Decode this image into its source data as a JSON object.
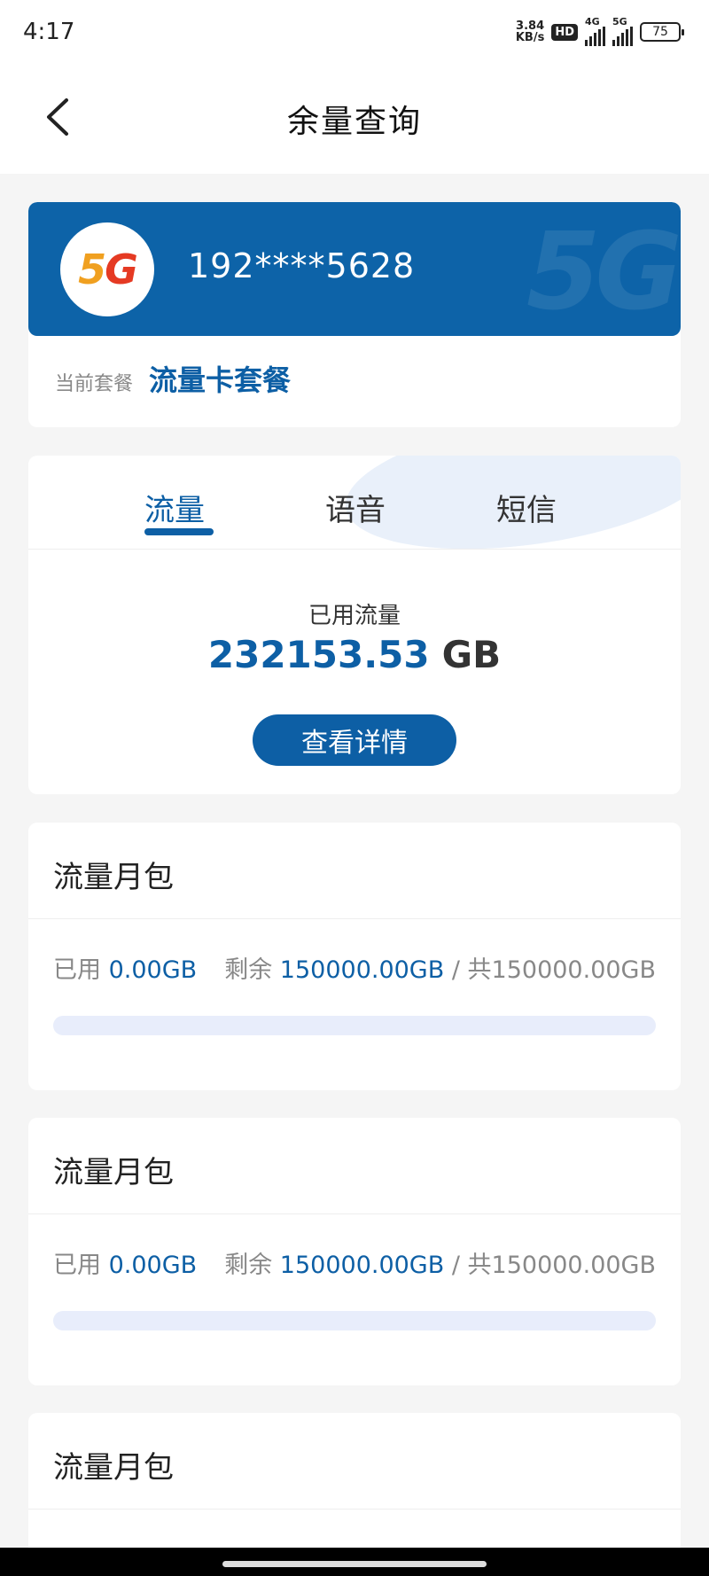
{
  "status_bar": {
    "time": "4:17",
    "net_speed_value": "3.84",
    "net_speed_unit": "KB/s",
    "hd_badge": "HD",
    "signal_1_label": "4G",
    "signal_2_label": "5G",
    "battery": "75"
  },
  "header": {
    "title": "余量查询",
    "back_icon": "chevron-left-icon"
  },
  "user_card": {
    "logo_text": "5G",
    "phone": "192****5628",
    "plan_label": "当前套餐",
    "plan_name": "流量卡套餐"
  },
  "usage": {
    "tabs": [
      {
        "label": "流量",
        "active": true
      },
      {
        "label": "语音",
        "active": false
      },
      {
        "label": "短信",
        "active": false
      }
    ],
    "used_label": "已用流量",
    "used_value": "232153.53",
    "used_unit": "GB",
    "detail_button": "查看详情"
  },
  "packages": [
    {
      "title": "流量月包",
      "used_label": "已用",
      "used_value": "0.00GB",
      "remain_label": "剩余",
      "remain_value": "150000.00GB",
      "total_text": "/ 共150000.00GB",
      "used_fraction": 0
    },
    {
      "title": "流量月包",
      "used_label": "已用",
      "used_value": "0.00GB",
      "remain_label": "剩余",
      "remain_value": "150000.00GB",
      "total_text": "/ 共150000.00GB",
      "used_fraction": 0
    },
    {
      "title": "流量月包"
    }
  ],
  "colors": {
    "brand_blue": "#0d5fa5",
    "page_bg": "#f5f5f5",
    "progress_track": "#e8edfb"
  }
}
